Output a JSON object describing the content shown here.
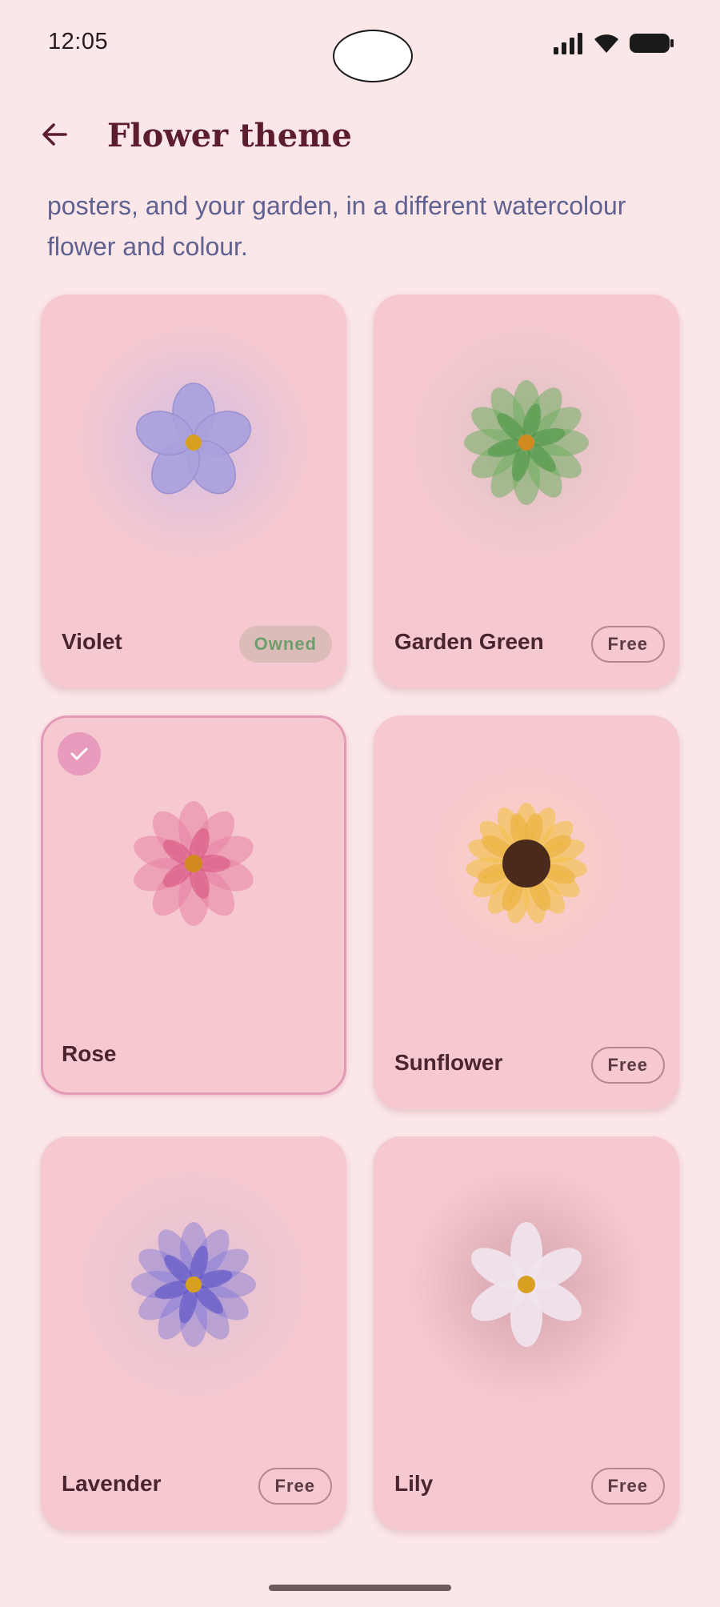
{
  "status_bar": {
    "time": "12:05"
  },
  "header": {
    "title": "Flower theme",
    "back_icon": "arrow-back-icon"
  },
  "description": "posters, and your garden, in a different watercolour flower and colour.",
  "themes": [
    {
      "name": "Violet",
      "badge": "Owned",
      "badge_type": "owned",
      "selected": false,
      "petal": "#a8a0dc",
      "center": "#d8a020"
    },
    {
      "name": "Garden Green",
      "badge": "Free",
      "badge_type": "free",
      "selected": false,
      "petal": "#6fae60",
      "center": "#d08a20"
    },
    {
      "name": "Rose",
      "badge": "",
      "badge_type": "none",
      "selected": true,
      "petal": "#e57b9f",
      "center": "#d08a20"
    },
    {
      "name": "Sunflower",
      "badge": "Free",
      "badge_type": "free",
      "selected": false,
      "petal": "#f2c24f",
      "center": "#4a2a1a"
    },
    {
      "name": "Lavender",
      "badge": "Free",
      "badge_type": "free",
      "selected": false,
      "petal": "#8078d6",
      "center": "#d8a020"
    },
    {
      "name": "Lily",
      "badge": "Free",
      "badge_type": "free",
      "selected": false,
      "petal": "#f0e4ee",
      "center": "#d8a020"
    }
  ],
  "colors": {
    "background": "#fbe6e8",
    "card": "#f6c9d0",
    "title": "#5c1e2c",
    "description": "#5f6190"
  }
}
